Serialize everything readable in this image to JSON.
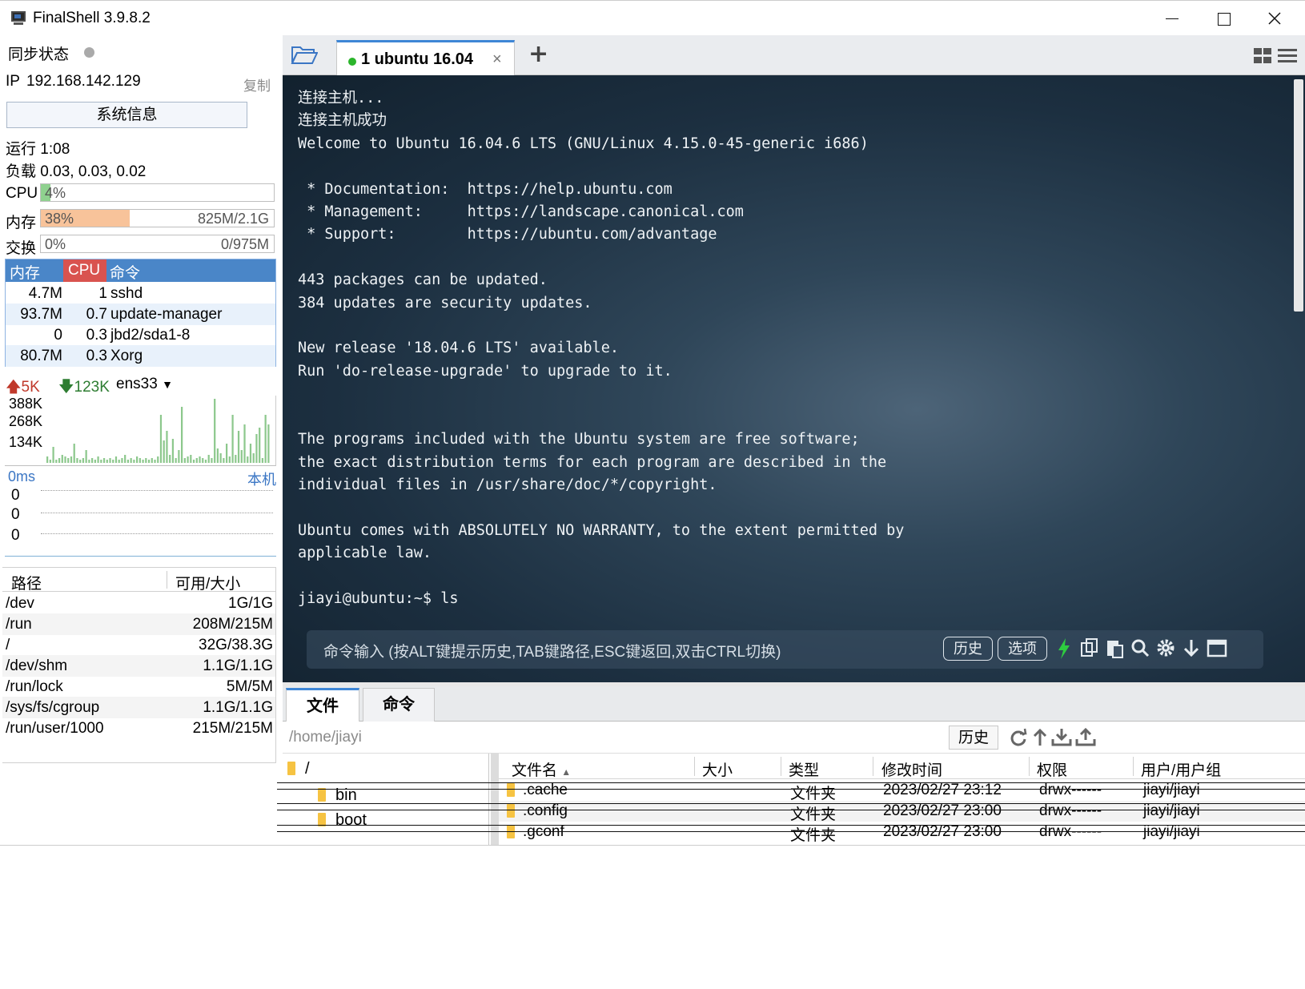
{
  "window": {
    "title": "FinalShell 3.9.8.2"
  },
  "left": {
    "sync_label": "同步状态",
    "ip_label": "IP",
    "ip_value": "192.168.142.129",
    "copy_label": "复制",
    "sysinfo_button": "系统信息",
    "uptime": "运行 1:08",
    "load": "负载 0.03, 0.03, 0.02",
    "cpu": {
      "label": "CPU",
      "pct_text": "4%",
      "fraction": 0.04
    },
    "mem": {
      "label": "内存",
      "pct_text": "38%",
      "fraction": 0.38,
      "detail": "825M/2.1G"
    },
    "swap": {
      "label": "交换",
      "pct_text": "0%",
      "fraction": 0.0,
      "detail": "0/975M"
    },
    "process_table": {
      "headers": [
        "内存",
        "CPU",
        "命令"
      ],
      "rows": [
        {
          "mem": "4.7M",
          "cpu": "1",
          "cmd": "sshd"
        },
        {
          "mem": "93.7M",
          "cpu": "0.7",
          "cmd": "update-manager"
        },
        {
          "mem": "0",
          "cpu": "0.3",
          "cmd": "jbd2/sda1-8"
        },
        {
          "mem": "80.7M",
          "cpu": "0.3",
          "cmd": "Xorg"
        }
      ]
    },
    "network": {
      "up": "5K",
      "down": "123K",
      "interface": "ens33",
      "y_labels": [
        "388K",
        "268K",
        "134K"
      ],
      "bars": [
        4,
        2,
        10,
        2,
        3,
        5,
        4,
        3,
        4,
        12,
        3,
        2,
        3,
        8,
        2,
        3,
        2,
        4,
        2,
        3,
        2,
        3,
        2,
        4,
        2,
        3,
        5,
        2,
        3,
        2,
        4,
        3,
        2,
        3,
        2,
        3,
        2,
        4,
        30,
        14,
        20,
        5,
        15,
        3,
        8,
        35,
        3,
        4,
        5,
        2,
        3,
        4,
        3,
        2,
        5,
        3,
        40,
        9,
        6,
        3,
        12,
        4,
        30,
        5,
        20,
        8,
        24,
        4,
        12,
        6,
        18,
        22,
        3,
        30,
        24
      ]
    },
    "latency": {
      "left_label": "0ms",
      "right_label": "本机",
      "rows": [
        "0",
        "0",
        "0"
      ]
    },
    "disk_table": {
      "headers": [
        "路径",
        "可用/大小"
      ],
      "rows": [
        {
          "path": "/dev",
          "size": "1G/1G"
        },
        {
          "path": "/run",
          "size": "208M/215M"
        },
        {
          "path": "/",
          "size": "32G/38.3G"
        },
        {
          "path": "/dev/shm",
          "size": "1.1G/1.1G"
        },
        {
          "path": "/run/lock",
          "size": "5M/5M"
        },
        {
          "path": "/sys/fs/cgroup",
          "size": "1.1G/1.1G"
        },
        {
          "path": "/run/user/1000",
          "size": "215M/215M"
        }
      ]
    }
  },
  "session_tab": {
    "label": "1 ubuntu 16.04",
    "close": "×",
    "add": "+"
  },
  "terminal": {
    "lines": [
      "连接主机...",
      "连接主机成功",
      "Welcome to Ubuntu 16.04.6 LTS (GNU/Linux 4.15.0-45-generic i686)",
      "",
      " * Documentation:  https://help.ubuntu.com",
      " * Management:     https://landscape.canonical.com",
      " * Support:        https://ubuntu.com/advantage",
      "",
      "443 packages can be updated.",
      "384 updates are security updates.",
      "",
      "New release '18.04.6 LTS' available.",
      "Run 'do-release-upgrade' to upgrade to it.",
      "",
      "",
      "The programs included with the Ubuntu system are free software;",
      "the exact distribution terms for each program are described in the",
      "individual files in /usr/share/doc/*/copyright.",
      "",
      "Ubuntu comes with ABSOLUTELY NO WARRANTY, to the extent permitted by",
      "applicable law.",
      "",
      "jiayi@ubuntu:~$ ls"
    ],
    "command_placeholder": "命令输入 (按ALT键提示历史,TAB键路径,ESC键返回,双击CTRL切换)",
    "history_button": "历史",
    "options_button": "选项"
  },
  "file_panel": {
    "tabs": [
      "文件",
      "命令"
    ],
    "path": "/home/jiayi",
    "history_button": "历史",
    "tree": {
      "root": "/",
      "nodes": [
        "bin",
        "boot"
      ]
    },
    "columns": [
      "文件名",
      "大小",
      "类型",
      "修改时间",
      "权限",
      "用户/用户组"
    ],
    "files": [
      {
        "name": ".cache",
        "size": "",
        "type": "文件夹",
        "mtime": "2023/02/27 23:12",
        "perm": "drwx------",
        "owner": "jiayi/jiayi"
      },
      {
        "name": ".config",
        "size": "",
        "type": "文件夹",
        "mtime": "2023/02/27 23:00",
        "perm": "drwx------",
        "owner": "jiayi/jiayi"
      },
      {
        "name": ".gconf",
        "size": "",
        "type": "文件夹",
        "mtime": "2023/02/27 23:00",
        "perm": "drwx------",
        "owner": "jiayi/jiayi"
      }
    ]
  },
  "colors": {
    "accent": "#3e86d6",
    "process_header": "#4a86c8",
    "cpu_header": "#d9534f",
    "cpu_bar": "#8fd18f",
    "mem_bar": "#f8c39a",
    "net_up": "#c0392b",
    "net_down": "#2e7d32",
    "net_graph": "#8dc88d"
  }
}
